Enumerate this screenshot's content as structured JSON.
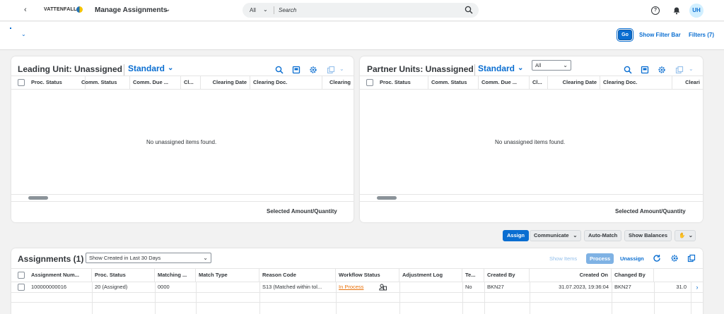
{
  "shell": {
    "back_icon": "chevron-left-icon",
    "logo_text": "VATTENFALL",
    "app_title": "Manage Assignments",
    "search_scope": "All",
    "search_placeholder": "Search",
    "avatar_initials": "UH"
  },
  "filter_bar": {
    "go_label": "Go",
    "show_filter_bar_label": "Show Filter Bar",
    "filters_label": "Filters (7)"
  },
  "leading_unit": {
    "title": "Leading Unit: Unassigned",
    "variant": "Standard",
    "columns": [
      "Proc. Status",
      "Comm. Status",
      "Comm. Due ...",
      "Cl...",
      "Clearing Date",
      "Clearing Doc.",
      "Clearing"
    ],
    "empty_text": "No unassigned items found.",
    "footer_label": "Selected Amount/Quantity"
  },
  "partner_units": {
    "title": "Partner Units: Unassigned",
    "variant": "Standard",
    "filter_value": "All",
    "columns": [
      "Proc. Status",
      "Comm. Status",
      "Comm. Due ...",
      "Cl...",
      "Clearing Date",
      "Clearing Doc.",
      "Cleari"
    ],
    "empty_text": "No unassigned items found.",
    "footer_label": "Selected Amount/Quantity"
  },
  "actions": {
    "assign": "Assign",
    "communicate": "Communicate",
    "auto_match": "Auto-Match",
    "show_balances": "Show Balances"
  },
  "assignments": {
    "title": "Assignments (1)",
    "period": "Show Created in Last 30 Days",
    "show_items": "Show Items",
    "process": "Process",
    "unassign": "Unassign",
    "columns": [
      "Assignment Num...",
      "Proc. Status",
      "Matching ...",
      "Match Type",
      "Reason Code",
      "Workflow Status",
      "Adjustment Log",
      "Te...",
      "Created By",
      "Created On",
      "Changed By",
      ""
    ],
    "rows": [
      {
        "assignment_num": "100000000016",
        "proc_status": "20 (Assigned)",
        "matching": "0000",
        "match_type": "",
        "reason_code": "S13 (Matched within tol...",
        "workflow_status": "In Process",
        "adjustment_log": "",
        "te": "No",
        "created_by": "BKN27",
        "created_on": "31.07.2023, 19:36:04",
        "changed_by": "BKN27",
        "changed_on": "31.0"
      }
    ]
  },
  "colors": {
    "accent": "#0a6ed1",
    "warning_link": "#e9730c"
  }
}
